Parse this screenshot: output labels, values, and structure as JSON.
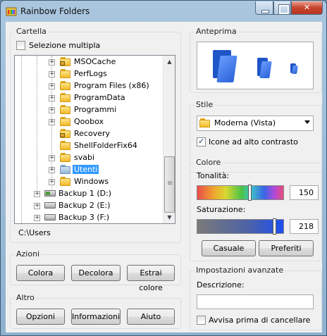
{
  "window": {
    "title": "Rainbow Folders"
  },
  "folder_group": {
    "label": "Cartella",
    "multi_select_label": "Selezione multipla",
    "multi_select_checked": false,
    "tree": [
      {
        "label": "MSOCache",
        "icon": "folder-lock"
      },
      {
        "label": "PerfLogs",
        "icon": "folder"
      },
      {
        "label": "Program Files (x86)",
        "icon": "folder"
      },
      {
        "label": "ProgramData",
        "icon": "folder"
      },
      {
        "label": "Programmi",
        "icon": "folder"
      },
      {
        "label": "Qoobox",
        "icon": "folder"
      },
      {
        "label": "Recovery",
        "icon": "folder-lock"
      },
      {
        "label": "ShellFolderFix64",
        "icon": "folder"
      },
      {
        "label": "svabi",
        "icon": "folder"
      },
      {
        "label": "Utenti",
        "icon": "folder-blue",
        "selected": true
      },
      {
        "label": "Windows",
        "icon": "folder"
      },
      {
        "label": "Backup 1 (D:)",
        "icon": "drive-green"
      },
      {
        "label": "Backup 2 (E:)",
        "icon": "drive"
      },
      {
        "label": "Backup 3 (F:)",
        "icon": "drive"
      }
    ],
    "path": "C:\\Users"
  },
  "actions_group": {
    "label": "Azioni",
    "buttons": {
      "colorize": "Colora",
      "decolorize": "Decolora",
      "extract": "Estrai colore"
    }
  },
  "other_group": {
    "label": "Altro",
    "buttons": {
      "options": "Opzioni",
      "info": "Informazioni",
      "help": "Aiuto"
    }
  },
  "preview_group": {
    "label": "Anteprima",
    "folder_color": "#2a63d8"
  },
  "style_group": {
    "label": "Stile",
    "style_value": "Moderna (Vista)",
    "high_contrast_label": "Icone ad alto contrasto",
    "high_contrast_checked": true
  },
  "color_group": {
    "label": "Colore",
    "hue_label": "Tonalità:",
    "hue_value": "150",
    "saturation_label": "Saturazione:",
    "saturation_value": "218",
    "random_button": "Casuale",
    "favorites_button": "Preferiti"
  },
  "advanced_group": {
    "label": "Impostazioni avanzate",
    "description_label": "Descrizione:",
    "description_value": "",
    "confirm_delete_label": "Avvisa prima di cancellare",
    "confirm_delete_checked": false
  }
}
